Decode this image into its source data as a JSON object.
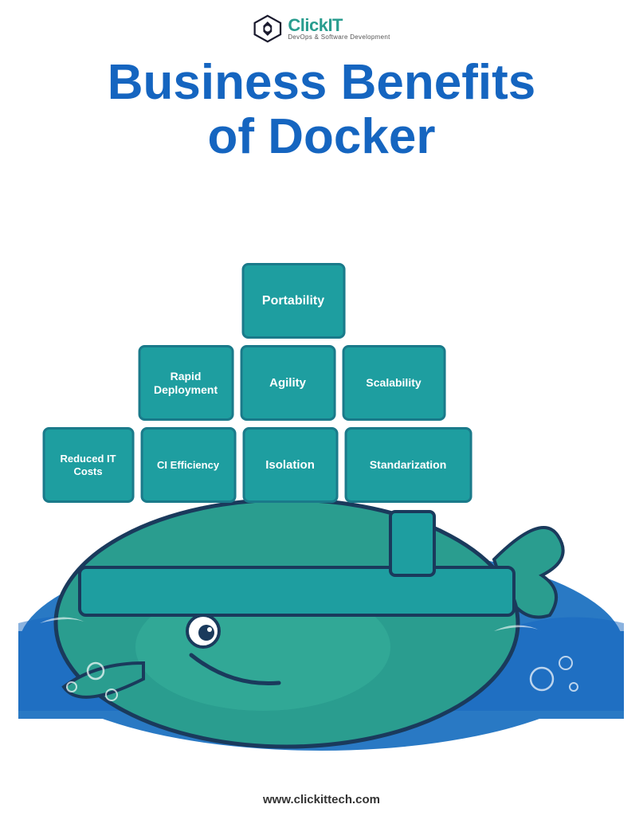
{
  "logo": {
    "name_part1": "Click",
    "name_part2": "IT",
    "tagline": "DevOps & Software Development"
  },
  "title": {
    "line1": "Business Benefits",
    "line2": "of Docker"
  },
  "boxes": {
    "row1": [
      {
        "id": "portability",
        "label": "Portability"
      }
    ],
    "row2": [
      {
        "id": "rapid-deployment",
        "label": "Rapid Deployment"
      },
      {
        "id": "agility",
        "label": "Agility"
      },
      {
        "id": "scalability",
        "label": "Scalability"
      }
    ],
    "row3": [
      {
        "id": "reduced-costs",
        "label": "Reduced IT Costs"
      },
      {
        "id": "ci-efficiency",
        "label": "CI Efficiency"
      },
      {
        "id": "isolation",
        "label": "Isolation"
      },
      {
        "id": "standarization",
        "label": "Standarization"
      }
    ]
  },
  "footer": {
    "url": "www.clickittech.com"
  },
  "colors": {
    "title_blue": "#1565c0",
    "box_teal": "#1e9ea0",
    "box_border": "#1a7a8a",
    "ocean": "#2979c4",
    "whale_body": "#2a9d8f",
    "whale_outline": "#1a3a5c"
  }
}
